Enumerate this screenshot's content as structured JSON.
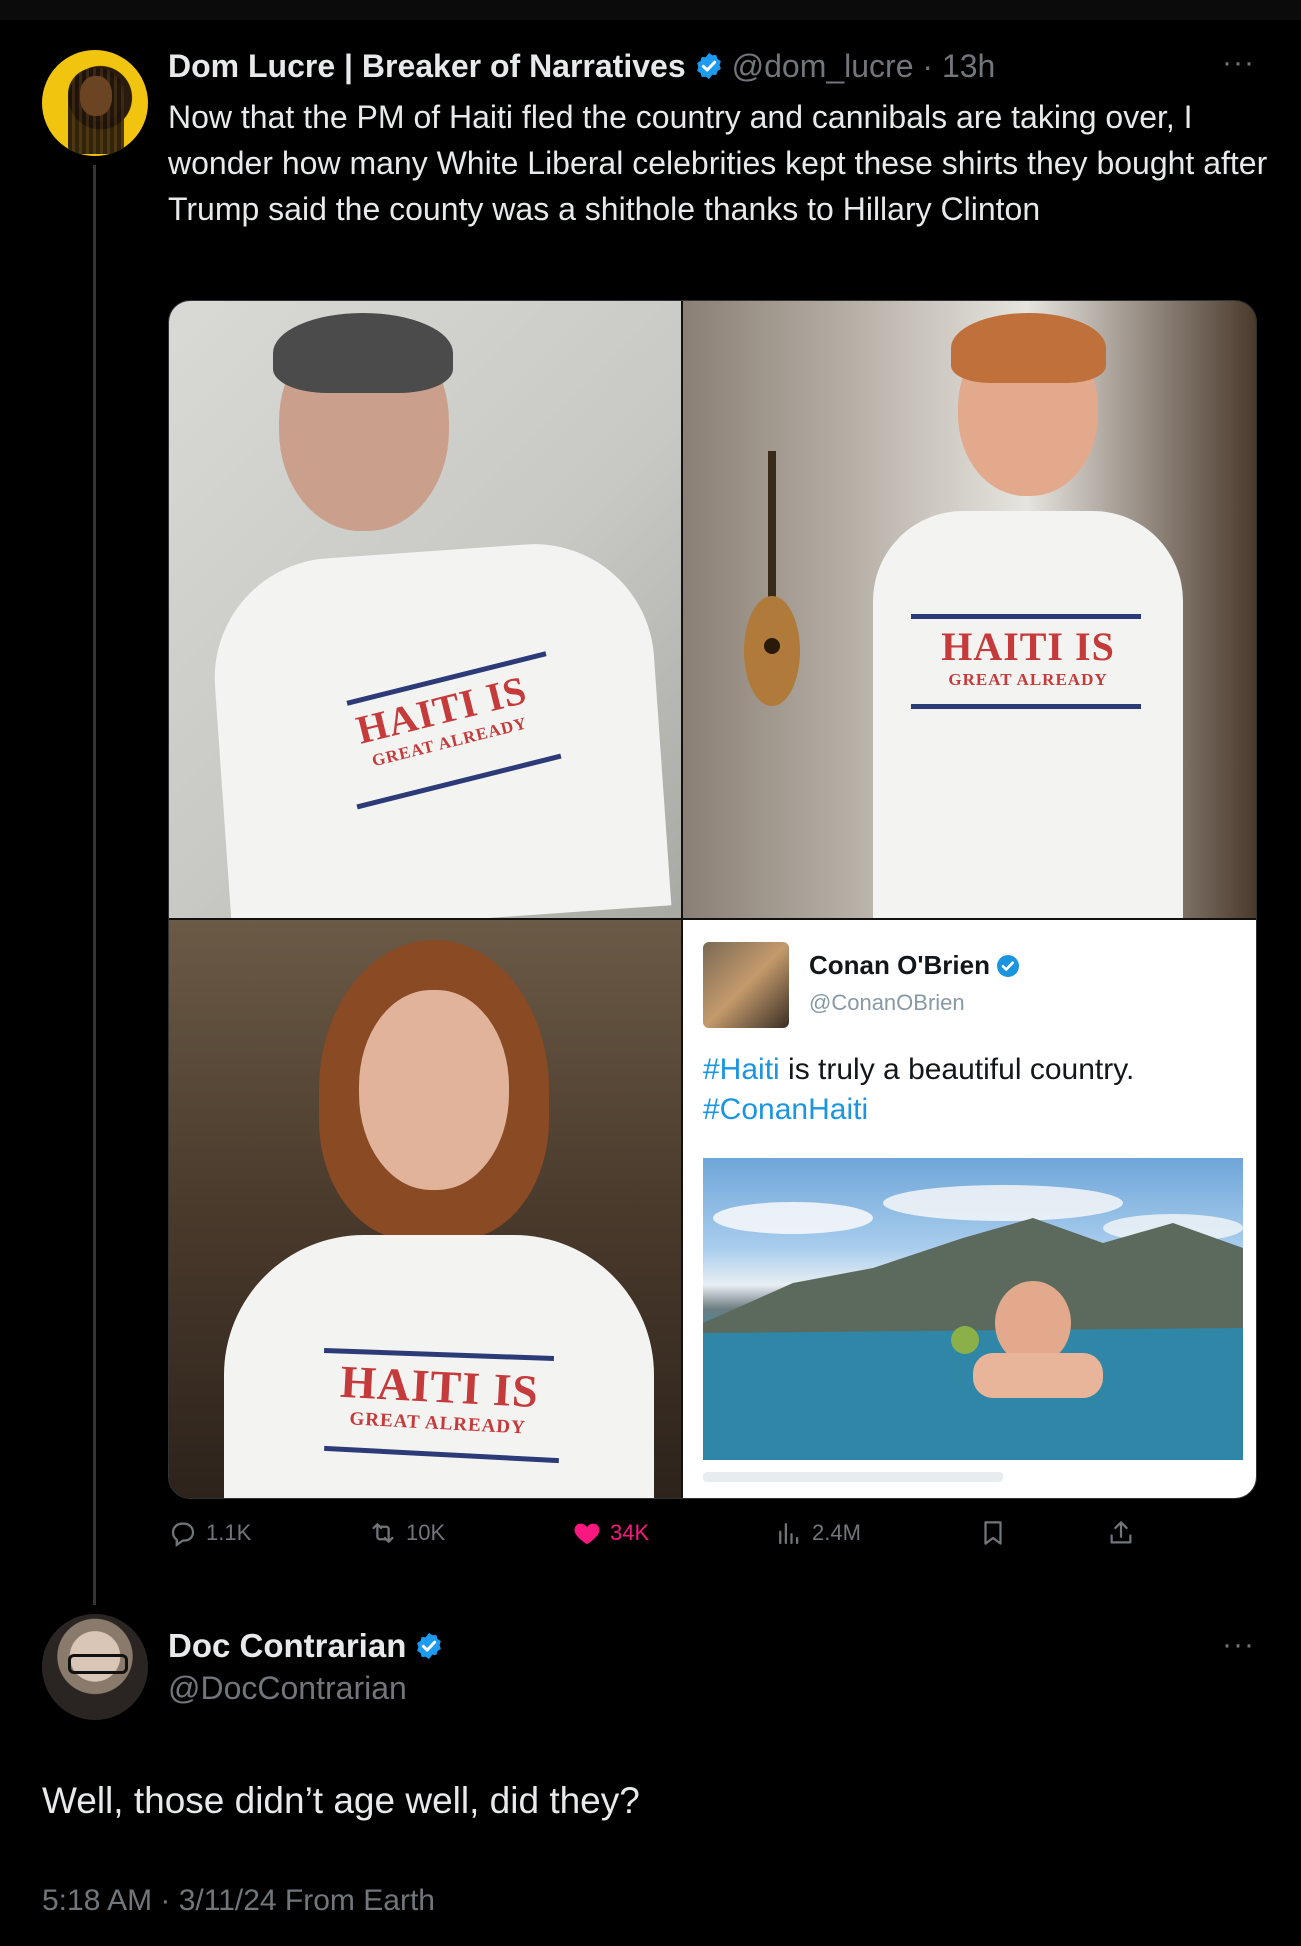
{
  "colors": {
    "background": "#000000",
    "text": "#e7e9ea",
    "muted": "#71767b",
    "verified": "#1d9bf0",
    "like": "#f91880",
    "link": "#1b95e0"
  },
  "tweet": {
    "author_name": "Dom Lucre | Breaker of Narratives",
    "handle_time": "@dom_lucre · 13h",
    "more": "···",
    "text": "Now that the PM of Haiti fled the country and cannibals are taking over, I wonder how many White Liberal celebrities kept these shirts they bought after Trump said the county was a shithole thanks to Hillary Clinton",
    "media": {
      "shirt_line1": "HAITI IS",
      "shirt_line2": "GREAT ALREADY",
      "embedded": {
        "name": "Conan O'Brien",
        "handle": "@ConanOBrien",
        "hashtag1": "#Haiti",
        "text_rest": " is truly a beautiful country.",
        "hashtag2": "#ConanHaiti"
      }
    },
    "actions": {
      "replies": "1.1K",
      "reposts": "10K",
      "likes": "34K",
      "views": "2.4M"
    }
  },
  "reply": {
    "author_name": "Doc Contrarian",
    "handle": "@DocContrarian",
    "more": "···",
    "text": "Well, those didn’t age well, did they?",
    "meta": "5:18 AM · 3/11/24 From Earth"
  }
}
